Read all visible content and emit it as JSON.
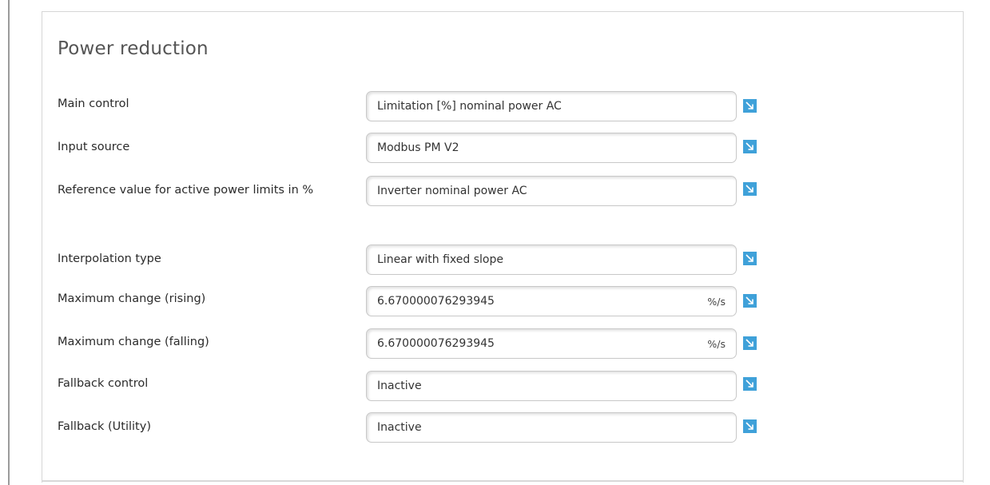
{
  "panel": {
    "title": "Power reduction"
  },
  "rows": [
    {
      "label": "Main control",
      "value": "Limitation [%] nominal power AC",
      "unit": ""
    },
    {
      "label": "Input source",
      "value": "Modbus PM V2",
      "unit": ""
    },
    {
      "label": "Reference value for active power limits in %",
      "value": "Inverter nominal power AC",
      "unit": ""
    },
    {
      "label": "Interpolation type",
      "value": "Linear with fixed slope",
      "unit": ""
    },
    {
      "label": "Maximum change (rising)",
      "value": "6.670000076293945",
      "unit": "%/s"
    },
    {
      "label": "Maximum change (falling)",
      "value": "6.670000076293945",
      "unit": "%/s"
    },
    {
      "label": "Fallback control",
      "value": "Inactive",
      "unit": ""
    },
    {
      "label": "Fallback (Utility)",
      "value": "Inactive",
      "unit": ""
    }
  ],
  "icons": {
    "help": "arrow-down-right-icon"
  },
  "colors": {
    "accent": "#3fa1d9",
    "title": "#555555",
    "text": "#2b2b2b",
    "field_border": "#c8c8c8"
  }
}
